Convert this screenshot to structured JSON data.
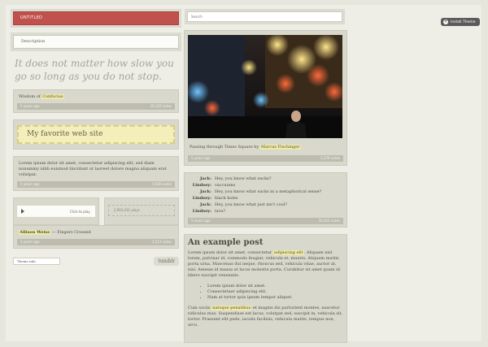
{
  "install": {
    "label": "Install Theme",
    "icon": "plus-circle-icon"
  },
  "blog": {
    "title": "UNTITLED",
    "description": "Description",
    "theme_placeholder": "Theme info",
    "tumblr_label": "tumblr"
  },
  "search": {
    "placeholder": "Search"
  },
  "left_posts": {
    "quote_text": "It does not matter how slow you go so long as you do not stop.",
    "quote_source_prefix": "Wisdom of ",
    "quote_source": "Confucius",
    "quote_meta_time": "5 years ago",
    "quote_meta_notes": "19,126 notes",
    "link_text": "My favorite web site",
    "text_body": "Lorem ipsum dolor sit amet, consectetur adipiscing elit, sed diam nonummy nibh euismod tincidunt ut laoreet dolore magna aliquam erat volutpat.",
    "text_meta_time": "5 years ago",
    "text_meta_notes": "5,626 notes",
    "audio_player_label": "Click to play",
    "audio_plays": "2,993,431 plays",
    "audio_artist": "Allison Weiss",
    "audio_track": " — Fingers Crossed",
    "audio_meta_time": "5 years ago",
    "audio_meta_notes": "2,211 notes"
  },
  "mid_posts": {
    "photo_caption_prefix": "Passing through Times Square by ",
    "photo_caption_author": "Marcus Fischinger",
    "photo_meta_time": "5 years ago",
    "photo_meta_notes": "5,378 notes",
    "chat": [
      {
        "name": "Jack:",
        "line": "Hey, you know what sucks?"
      },
      {
        "name": "Lindsey:",
        "line": "vaccuums"
      },
      {
        "name": "Jack:",
        "line": "Hey, you know what sucks in a metaphorical sense?"
      },
      {
        "name": "Lindsey:",
        "line": "black holes"
      },
      {
        "name": "Jack:",
        "line": "Hey, you know what just isn't cool?"
      },
      {
        "name": "Lindsey:",
        "line": "lava?"
      }
    ],
    "chat_meta_time": "5 years ago",
    "chat_meta_notes": "10,422 notes",
    "post_title": "An example post",
    "post_p1_a": "Lorem ipsum dolor sit amet, consectetur ",
    "post_p1_hl": "adipiscing elit",
    "post_p1_b": ". Aliquam nisl lorem, pulvinar id, commodo feugiat, vehicula et, mauris. Aliquam mattis porta urna. Maecenas dui neque, rhoncus sed, vehicula vitae, auctor at, nisi. Aenean id massa ut lacus molestie porta. Curabitur sit amet quam id libero suscipit venenatis.",
    "post_list": [
      "Lorem ipsum dolor sit amet.",
      "Consectetuer adipiscing elit.",
      "Nam at tortor quis ipsum tempor aliquet."
    ],
    "post_p2_a": "Cum sociis ",
    "post_p2_hl": "natoque penatibus",
    "post_p2_b": " et magnis dis parturient montes, nascetur ridiculus mus. Suspendisse est lacus, volutpat sed, suscipit in, vehicula sit, tortor. Praesent elit pede, iaculis facilisis, vehicula mattis, tempus non, arcu."
  }
}
